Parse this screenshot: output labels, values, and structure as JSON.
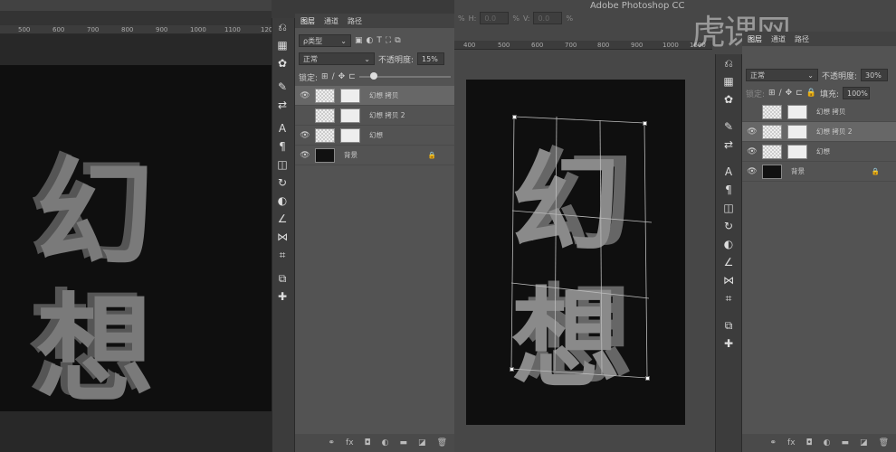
{
  "left": {
    "ruler": [
      "500",
      "600",
      "700",
      "800",
      "900",
      "1000",
      "1100",
      "120"
    ],
    "doc_text": [
      "幻",
      "想"
    ],
    "panel": {
      "tabs": [
        "图层",
        "通道",
        "路径"
      ],
      "filter": "ρ类型",
      "blend": "正常",
      "opacity_label": "不透明度:",
      "opacity": "15%",
      "lock_label": "锁定:",
      "layers": [
        {
          "name": "幻想 拷贝",
          "visible": true,
          "active": true,
          "type": "smart"
        },
        {
          "name": "幻想 拷贝 2",
          "visible": false,
          "active": false,
          "type": "smart"
        },
        {
          "name": "幻想",
          "visible": true,
          "active": false,
          "type": "smart"
        },
        {
          "name": "背景",
          "visible": true,
          "active": false,
          "type": "bg",
          "locked": true
        }
      ],
      "footer": [
        "link",
        "fx",
        "mask",
        "adjust",
        "folder",
        "new",
        "trash"
      ]
    }
  },
  "right": {
    "title": "Adobe Photoshop CC",
    "options": {
      "h_label": "H:",
      "h": "0.0",
      "v_label": "V:",
      "v": "0.0",
      "pct": "%"
    },
    "ruler": [
      "400",
      "500",
      "600",
      "700",
      "800",
      "900",
      "1000",
      "1600"
    ],
    "watermark": "虎课网",
    "doc_text": [
      "幻",
      "想"
    ],
    "panel": {
      "tabs": [
        "图层",
        "通道",
        "路径"
      ],
      "blend": "正常",
      "opacity_label": "不透明度:",
      "opacity": "30%",
      "lock_label": "锁定:",
      "fill_label": "填充:",
      "fill": "100%",
      "layers": [
        {
          "name": "幻想 拷贝",
          "visible": false,
          "active": false
        },
        {
          "name": "幻想 拷贝 2",
          "visible": true,
          "active": true
        },
        {
          "name": "幻想",
          "visible": true,
          "active": false
        },
        {
          "name": "背景",
          "visible": true,
          "active": false,
          "locked": true
        }
      ]
    }
  }
}
